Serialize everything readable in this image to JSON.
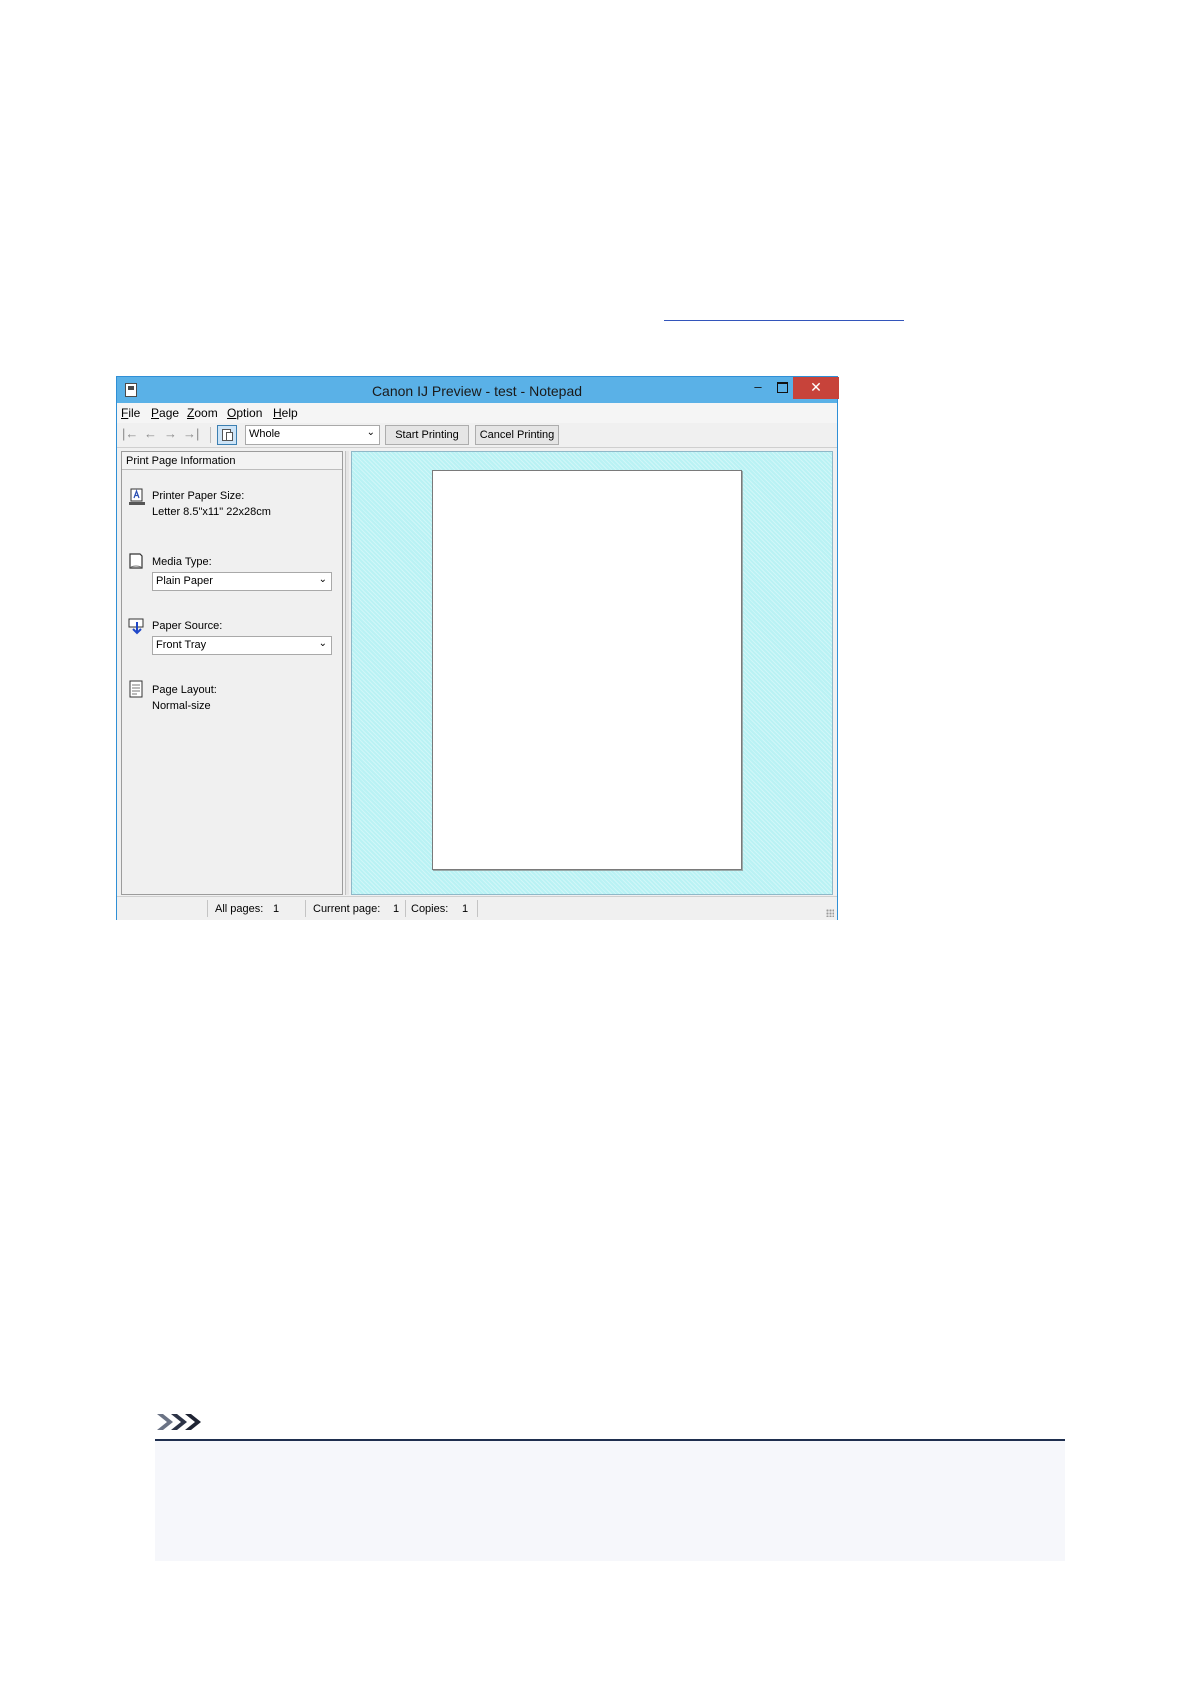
{
  "window": {
    "title": "Canon IJ Preview - test - Notepad",
    "minimize_glyph": "–",
    "close_glyph": "✕"
  },
  "menu": [
    {
      "label": "File",
      "accel": "F",
      "rest": "ile"
    },
    {
      "label": "Page",
      "accel": "P",
      "rest": "age"
    },
    {
      "label": "Zoom",
      "accel": "Z",
      "rest": "oom"
    },
    {
      "label": "Option",
      "accel": "O",
      "rest": "ption"
    },
    {
      "label": "Help",
      "accel": "H",
      "rest": "elp"
    }
  ],
  "toolbar": {
    "first_page_icon": "|←",
    "prev_page_icon": "←",
    "next_page_icon": "→",
    "last_page_icon": "→|",
    "zoom_value": "Whole",
    "dropdown_arrow": "⌄",
    "start_label": "Start Printing",
    "cancel_label": "Cancel Printing"
  },
  "panel": {
    "header": "Print Page Information",
    "paper_size_label": "Printer Paper Size:",
    "paper_size_value": "Letter 8.5\"x11\" 22x28cm",
    "media_type_label": "Media Type:",
    "media_type_value": "Plain Paper",
    "paper_source_label": "Paper Source:",
    "paper_source_value": "Front Tray",
    "page_layout_label": "Page Layout:",
    "page_layout_value": "Normal-size"
  },
  "status": {
    "all_pages_label": "All pages:",
    "all_pages_value": "1",
    "current_page_label": "Current page:",
    "current_page_value": "1",
    "copies_label": "Copies:",
    "copies_value": "1"
  },
  "colors": {
    "titlebar": "#5ab1e7",
    "close_button": "#c7433a",
    "preview_background": "#b9f2f4",
    "link": "#3355bb",
    "note_rule": "#1f2f4f"
  }
}
